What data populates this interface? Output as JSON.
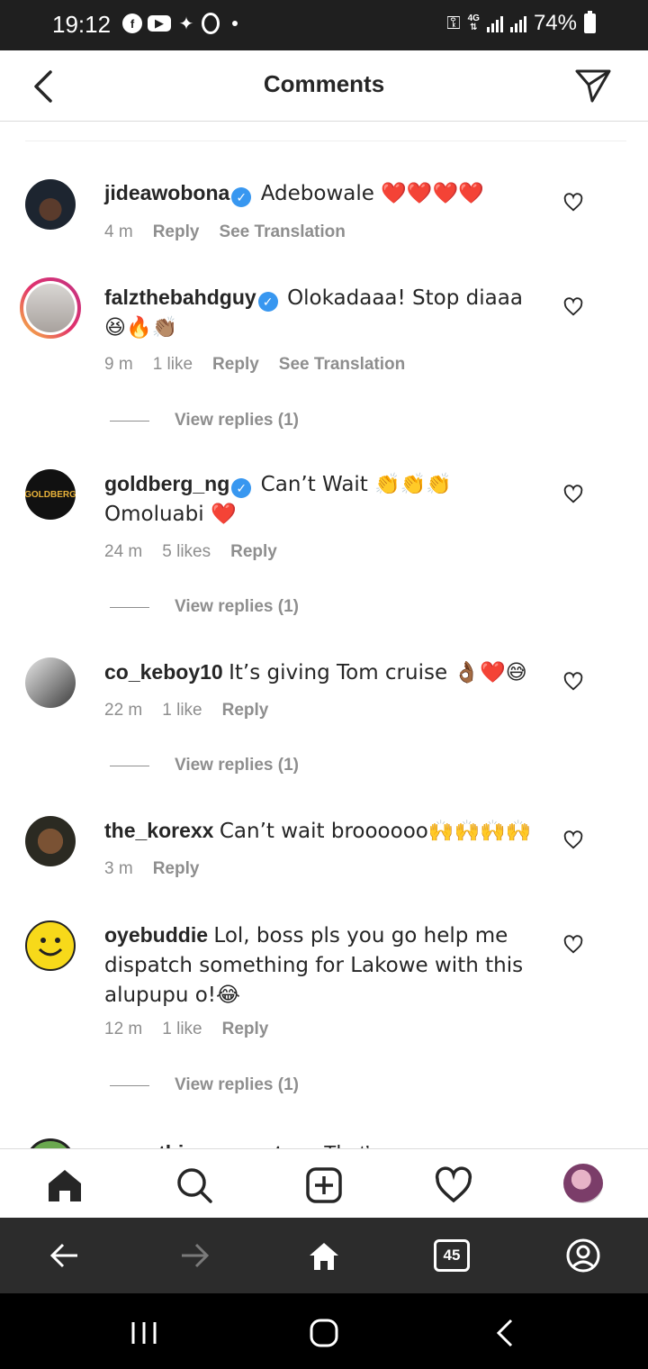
{
  "status_bar": {
    "time": "19:12",
    "left_icons": [
      "facebook-icon",
      "youtube-icon",
      "twitter-icon",
      "opera-icon",
      "dot"
    ],
    "network": "4G",
    "battery": "74%"
  },
  "header": {
    "title": "Comments",
    "back_icon": "chevron-left-icon",
    "share_icon": "send-icon"
  },
  "comments": [
    {
      "username": "jideawobona",
      "verified": true,
      "text": "Adebowale ❤️❤️❤️❤️",
      "time": "4 m",
      "likes": "",
      "reply": "Reply",
      "translation": "See Translation",
      "view_replies": ""
    },
    {
      "username": "falzthebahdguy",
      "verified": true,
      "text": "Olokadaaa! Stop diaaa 😆🔥👏🏽",
      "time": "9 m",
      "likes": "1 like",
      "reply": "Reply",
      "translation": "See Translation",
      "view_replies": "View replies (1)"
    },
    {
      "username": "goldberg_ng",
      "verified": true,
      "text": "Can’t Wait 👏👏👏 Omoluabi ❤️",
      "time": "24 m",
      "likes": "5 likes",
      "reply": "Reply",
      "translation": "",
      "view_replies": "View replies (1)"
    },
    {
      "username": "co_keboy10",
      "verified": false,
      "text": "It’s giving Tom cruise 👌🏾❤️😅",
      "time": "22 m",
      "likes": "1 like",
      "reply": "Reply",
      "translation": "",
      "view_replies": "View replies (1)"
    },
    {
      "username": "the_korexx",
      "verified": false,
      "text": "Can’t wait broooooo🙌🙌🙌🙌",
      "time": "3 m",
      "likes": "",
      "reply": "Reply",
      "translation": "",
      "view_replies": ""
    },
    {
      "username": "oyebuddie",
      "verified": false,
      "text": "Lol, boss pls you go help me dispatch something for Lakowe with this alupupu o!😂",
      "time": "12 m",
      "likes": "1 like",
      "reply": "Reply",
      "translation": "",
      "view_replies": "View replies (1)"
    },
    {
      "username": "everythingpropertyng",
      "verified": false,
      "text": "That’s some",
      "time": "",
      "likes": "",
      "reply": "",
      "translation": "",
      "view_replies": ""
    }
  ],
  "avatar_labels": {
    "goldberg": "GOLDBERG"
  },
  "tab_bar": [
    "home-icon",
    "search-icon",
    "new-post-icon",
    "activity-heart-icon",
    "profile-avatar"
  ],
  "browser_bar": {
    "tabs_count": "45",
    "icons": [
      "back-arrow-icon",
      "forward-arrow-icon",
      "home-icon",
      "tabs-icon",
      "account-icon"
    ]
  },
  "colors": {
    "status_bar": "#1f1f1f",
    "verified": "#3897f0",
    "meta_text": "#8e8e8e",
    "browser_bar": "#2c2c2c"
  }
}
